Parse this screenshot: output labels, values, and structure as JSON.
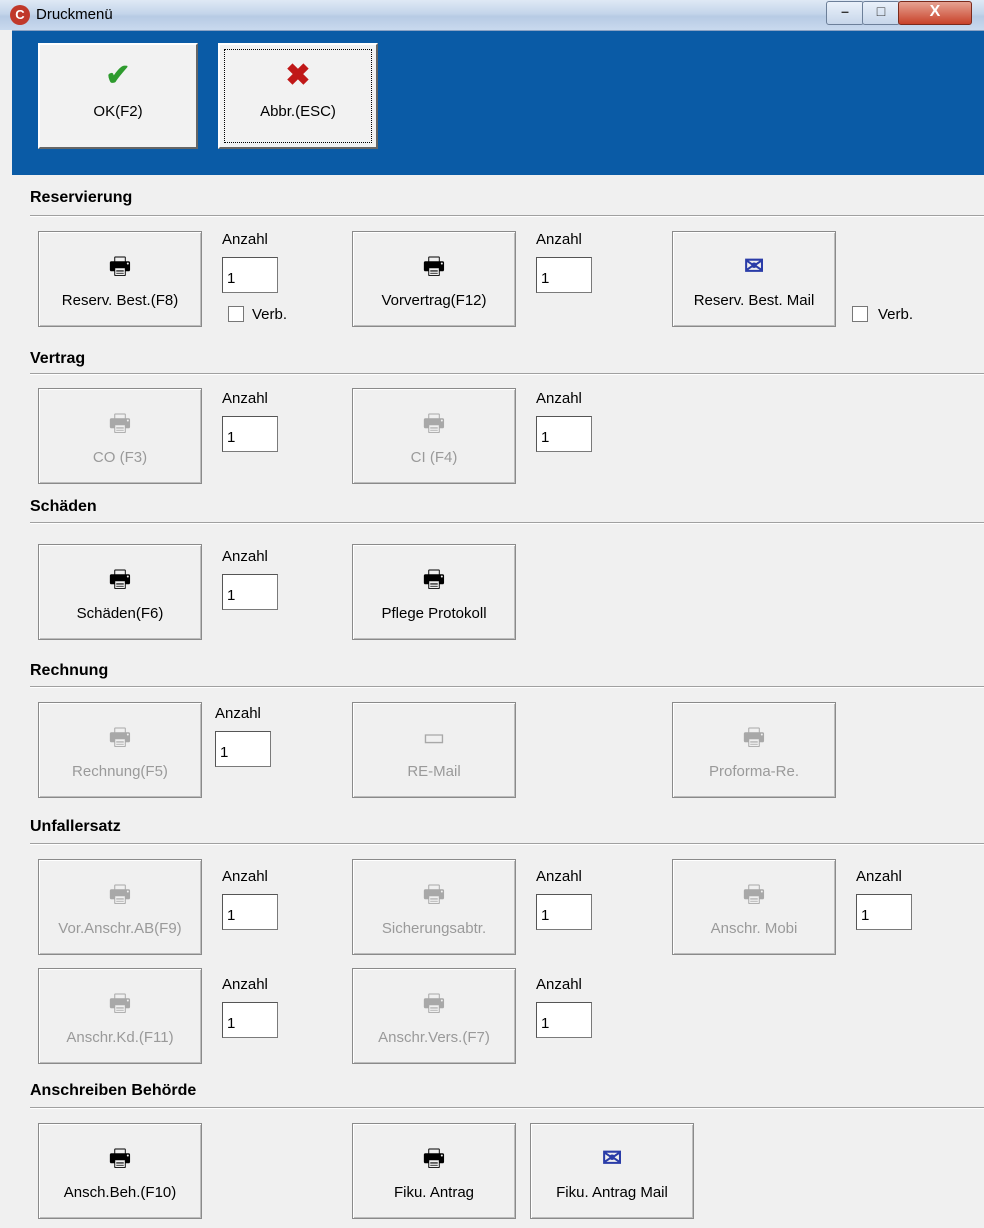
{
  "window": {
    "title": "Druckmenü",
    "close_glyph": "X"
  },
  "toolbar": {
    "ok_label": "OK(F2)",
    "ok_icon": "check-icon",
    "cancel_label": "Abbr.(ESC)",
    "cancel_icon": "cross-icon"
  },
  "common": {
    "anzahl": "Anzahl",
    "verb": "Verb."
  },
  "sections": {
    "reservierung": {
      "title": "Reservierung",
      "reserv_best": {
        "label": "Reserv. Best.(F8)",
        "count": "1",
        "verb_checked": false
      },
      "vorvertrag": {
        "label": "Vorvertrag(F12)",
        "count": "1"
      },
      "reserv_best_mail": {
        "label": "Reserv. Best. Mail",
        "verb_checked": false
      }
    },
    "vertrag": {
      "title": "Vertrag",
      "co": {
        "label": "CO (F3)",
        "count": "1",
        "enabled": false
      },
      "ci": {
        "label": "CI (F4)",
        "count": "1",
        "enabled": false
      }
    },
    "schaeden": {
      "title": "Schäden",
      "schaeden": {
        "label": "Schäden(F6)",
        "count": "1"
      },
      "pflege": {
        "label": "Pflege Protokoll"
      }
    },
    "rechnung": {
      "title": "Rechnung",
      "rechnung": {
        "label": "Rechnung(F5)",
        "count": "1",
        "enabled": false
      },
      "re_mail": {
        "label": "RE-Mail",
        "enabled": false
      },
      "proforma": {
        "label": "Proforma-Re.",
        "enabled": false
      }
    },
    "unfallersatz": {
      "title": "Unfallersatz",
      "vor_anschr": {
        "label": "Vor.Anschr.AB(F9)",
        "count": "1",
        "enabled": false
      },
      "sicherung": {
        "label": "Sicherungsabtr.",
        "count": "1",
        "enabled": false
      },
      "anschr_mobi": {
        "label": "Anschr. Mobi",
        "count": "1",
        "enabled": false
      },
      "anschr_kd": {
        "label": "Anschr.Kd.(F11)",
        "count": "1",
        "enabled": false
      },
      "anschr_vers": {
        "label": "Anschr.Vers.(F7)",
        "count": "1",
        "enabled": false
      }
    },
    "behoerde": {
      "title": "Anschreiben Behörde",
      "ansch_beh": {
        "label": "Ansch.Beh.(F10)"
      },
      "fiku": {
        "label": "Fiku. Antrag"
      },
      "fiku_mail": {
        "label": "Fiku. Antrag Mail"
      }
    }
  }
}
